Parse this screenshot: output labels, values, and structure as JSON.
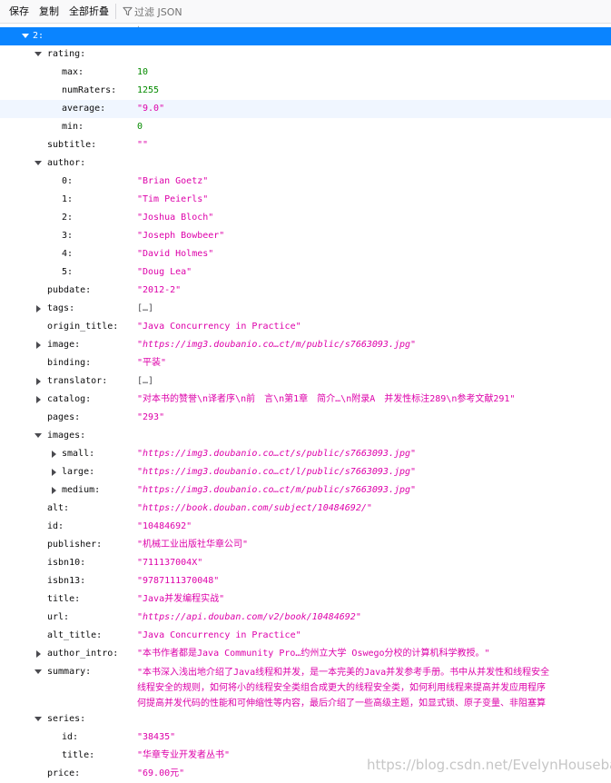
{
  "toolbar": {
    "save_label": "保存",
    "copy_label": "复制",
    "collapse_label": "全部折叠",
    "filter_placeholder": "过滤 JSON"
  },
  "tree": {
    "book_key": "2:",
    "rating": {
      "key": "rating:",
      "max_key": "max:",
      "max": "10",
      "numRaters_key": "numRaters:",
      "numRaters": "1255",
      "average_key": "average:",
      "average": "\"9.0\"",
      "min_key": "min:",
      "min": "0"
    },
    "subtitle_key": "subtitle:",
    "subtitle": "\"\"",
    "author": {
      "key": "author:",
      "items": [
        {
          "key": "0:",
          "value": "\"Brian Goetz\""
        },
        {
          "key": "1:",
          "value": "\"Tim Peierls\""
        },
        {
          "key": "2:",
          "value": "\"Joshua Bloch\""
        },
        {
          "key": "3:",
          "value": "\"Joseph Bowbeer\""
        },
        {
          "key": "4:",
          "value": "\"David Holmes\""
        },
        {
          "key": "5:",
          "value": "\"Doug Lea\""
        }
      ]
    },
    "pubdate_key": "pubdate:",
    "pubdate": "\"2012-2\"",
    "tags_key": "tags:",
    "tags": "[…]",
    "origin_title_key": "origin_title:",
    "origin_title": "\"Java Concurrency in Practice\"",
    "image_key": "image:",
    "image": "\"https://img3.doubanio.co…ct/m/public/s7663093.jpg\"",
    "binding_key": "binding:",
    "binding": "\"平装\"",
    "translator_key": "translator:",
    "translator": "[…]",
    "catalog_key": "catalog:",
    "catalog": "\"对本书的赞誉\\n译者序\\n前　言\\n第1章　简介…\\n附录A　并发性标注289\\n参考文献291\"",
    "pages_key": "pages:",
    "pages": "\"293\"",
    "images": {
      "key": "images:",
      "small_key": "small:",
      "small": "\"https://img3.doubanio.co…ct/s/public/s7663093.jpg\"",
      "large_key": "large:",
      "large": "\"https://img3.doubanio.co…ct/l/public/s7663093.jpg\"",
      "medium_key": "medium:",
      "medium": "\"https://img3.doubanio.co…ct/m/public/s7663093.jpg\""
    },
    "alt_key": "alt:",
    "alt": "\"https://book.douban.com/subject/10484692/\"",
    "id_key": "id:",
    "id": "\"10484692\"",
    "publisher_key": "publisher:",
    "publisher": "\"机械工业出版社华章公司\"",
    "isbn10_key": "isbn10:",
    "isbn10": "\"711137004X\"",
    "isbn13_key": "isbn13:",
    "isbn13": "\"9787111370048\"",
    "title_key": "title:",
    "title": "\"Java并发编程实战\"",
    "url_key": "url:",
    "url": "\"https://api.douban.com/v2/book/10484692\"",
    "alt_title_key": "alt_title:",
    "alt_title": "\"Java Concurrency in Practice\"",
    "author_intro_key": "author_intro:",
    "author_intro": "\"本书作者都是Java Community Pro…约州立大学 Oswego分校的计算机科学教授。\"",
    "summary_key": "summary:",
    "summary_lines": [
      "\"本书深入浅出地介绍了Java线程和并发，是一本完美的Java并发参考手册。书中从并发性和线程安全",
      "线程安全的规则，如何将小的线程安全类组合成更大的线程安全类，如何利用线程来提高并发应用程序",
      "何提高并发代码的性能和可伸缩性等内容，最后介绍了一些高级主题，如显式锁、原子变量、非阻塞算"
    ],
    "series": {
      "key": "series:",
      "id_key": "id:",
      "id": "\"38435\"",
      "title_key": "title:",
      "title": "\"华章专业开发者丛书\""
    },
    "price_key": "price:",
    "price": "\"69.00元\""
  },
  "watermark": "https://blog.csdn.net/EvelynHouseba",
  "colors": {
    "selected_row": "#0a84ff",
    "string": "#dd00a9",
    "number": "#058b00",
    "toolbar_bg": "#f9f9fa"
  }
}
